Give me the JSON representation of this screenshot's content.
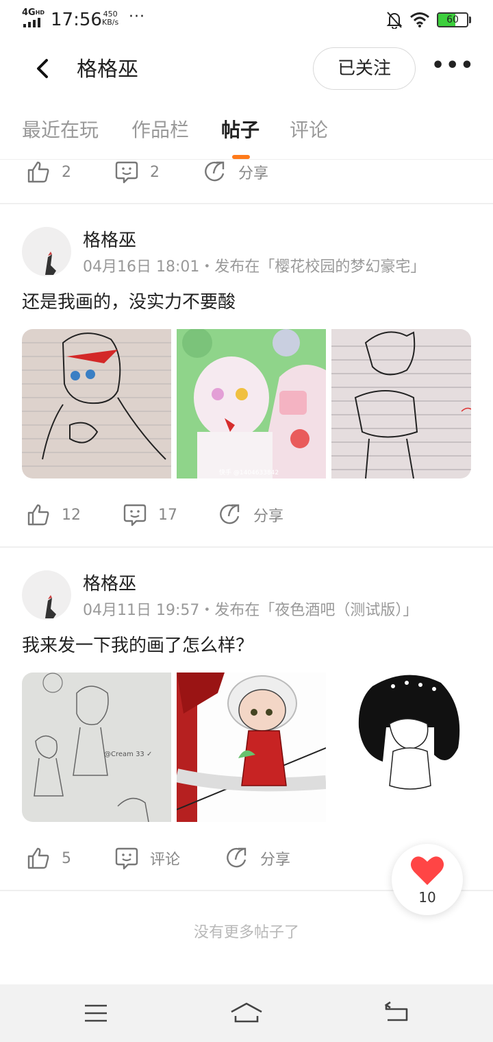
{
  "status_bar": {
    "network": "4G",
    "network_sup": "HD",
    "time": "17:56",
    "speed_value": "450",
    "speed_unit": "KB/s",
    "dots": "···",
    "battery": "60",
    "battery_level_percent": 60
  },
  "header": {
    "title": "格格巫",
    "follow_label": "已关注",
    "more_label": "•••"
  },
  "tabs": [
    {
      "label": "最近在玩",
      "active": false
    },
    {
      "label": "作品栏",
      "active": false
    },
    {
      "label": "帖子",
      "active": true
    },
    {
      "label": "评论",
      "active": false
    }
  ],
  "top_actions": {
    "likes": "2",
    "comments": "2",
    "share": "分享"
  },
  "posts": [
    {
      "author": "格格巫",
      "meta": "04月16日 18:01・发布在「樱花校园的梦幻豪宅」",
      "text": "还是我画的，没实力不要酸",
      "images": [
        "sketch-girl-drawing",
        "green-hood-girl-drawing",
        "sketch-boy-drawing"
      ],
      "watermark": "快手 @1404633842",
      "likes": "12",
      "comments": "17",
      "share": "分享"
    },
    {
      "author": "格格巫",
      "meta": "04月11日 19:57・发布在「夜色酒吧（测试版）」",
      "text": "我来发一下我的画了怎么样？",
      "images": [
        "pencil-sketch-drawing",
        "red-robe-character-drawing",
        "black-hair-character-drawing"
      ],
      "sketch_signature": "@Cream 33 ✓",
      "likes": "5",
      "comments": "评论",
      "share": "分享"
    }
  ],
  "footer_text": "没有更多帖子了",
  "floating_like": {
    "count": "10",
    "color": "#ff4545"
  },
  "colors": {
    "accent": "#ff7a1a",
    "muted": "#999999",
    "battery": "#3ccf3c"
  }
}
